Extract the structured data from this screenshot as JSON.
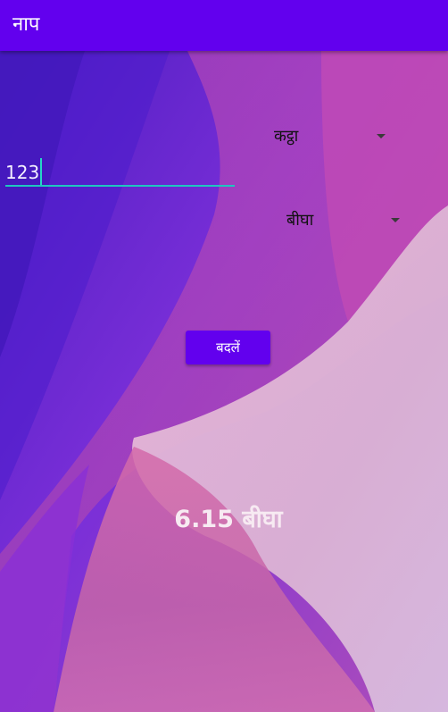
{
  "app": {
    "title": "नाप"
  },
  "converter": {
    "from_unit": "कट्ठा",
    "input_value": "123",
    "to_unit": "बीघा",
    "convert_button_label": "बदलें",
    "result_text": "6.15 बीघा"
  },
  "colors": {
    "primary": "#6200ee",
    "accent": "#1fc6c0",
    "on_primary": "#ffffff"
  },
  "icons": {
    "dropdown": "triangle-down"
  }
}
